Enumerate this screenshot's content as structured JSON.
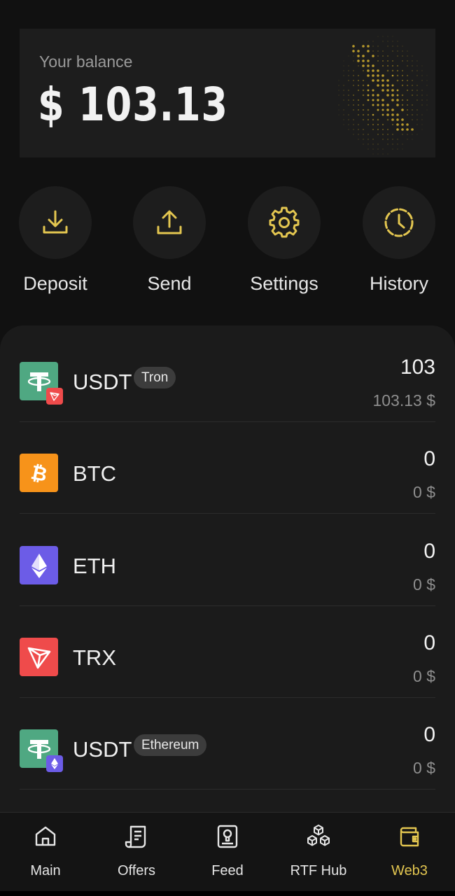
{
  "balance": {
    "label": "Your balance",
    "value": "$ 103.13"
  },
  "actions": [
    {
      "label": "Deposit",
      "icon": "download-icon"
    },
    {
      "label": "Send",
      "icon": "upload-icon"
    },
    {
      "label": "Settings",
      "icon": "gear-icon"
    },
    {
      "label": "History",
      "icon": "clock-icon"
    }
  ],
  "assets": [
    {
      "ticker": "USDT",
      "network": "Tron",
      "amount": "103",
      "fiat": "103.13 $",
      "coin_icon": "tether-icon",
      "badge_icon": "tron-icon",
      "coin_color": "#4fa882"
    },
    {
      "ticker": "BTC",
      "network": "",
      "amount": "0",
      "fiat": "0 $",
      "coin_icon": "bitcoin-icon",
      "coin_color": "#f7931a"
    },
    {
      "ticker": "ETH",
      "network": "",
      "amount": "0",
      "fiat": "0 $",
      "coin_icon": "ethereum-icon",
      "coin_color": "#6c5ce7"
    },
    {
      "ticker": "TRX",
      "network": "",
      "amount": "0",
      "fiat": "0 $",
      "coin_icon": "tron-icon",
      "coin_color": "#ef4b4b"
    },
    {
      "ticker": "USDT",
      "network": "Ethereum",
      "amount": "0",
      "fiat": "0 $",
      "coin_icon": "tether-icon",
      "badge_icon": "ethereum-icon",
      "coin_color": "#4fa882"
    }
  ],
  "nav": [
    {
      "label": "Main",
      "icon": "home-icon",
      "active": false
    },
    {
      "label": "Offers",
      "icon": "scroll-icon",
      "active": false
    },
    {
      "label": "Feed",
      "icon": "feed-icon",
      "active": false
    },
    {
      "label": "RTF Hub",
      "icon": "cubes-icon",
      "active": false
    },
    {
      "label": "Web3",
      "icon": "wallet-icon",
      "active": true
    }
  ],
  "colors": {
    "accent": "#e3c650",
    "background": "#111111",
    "card": "#1d1d1d"
  }
}
